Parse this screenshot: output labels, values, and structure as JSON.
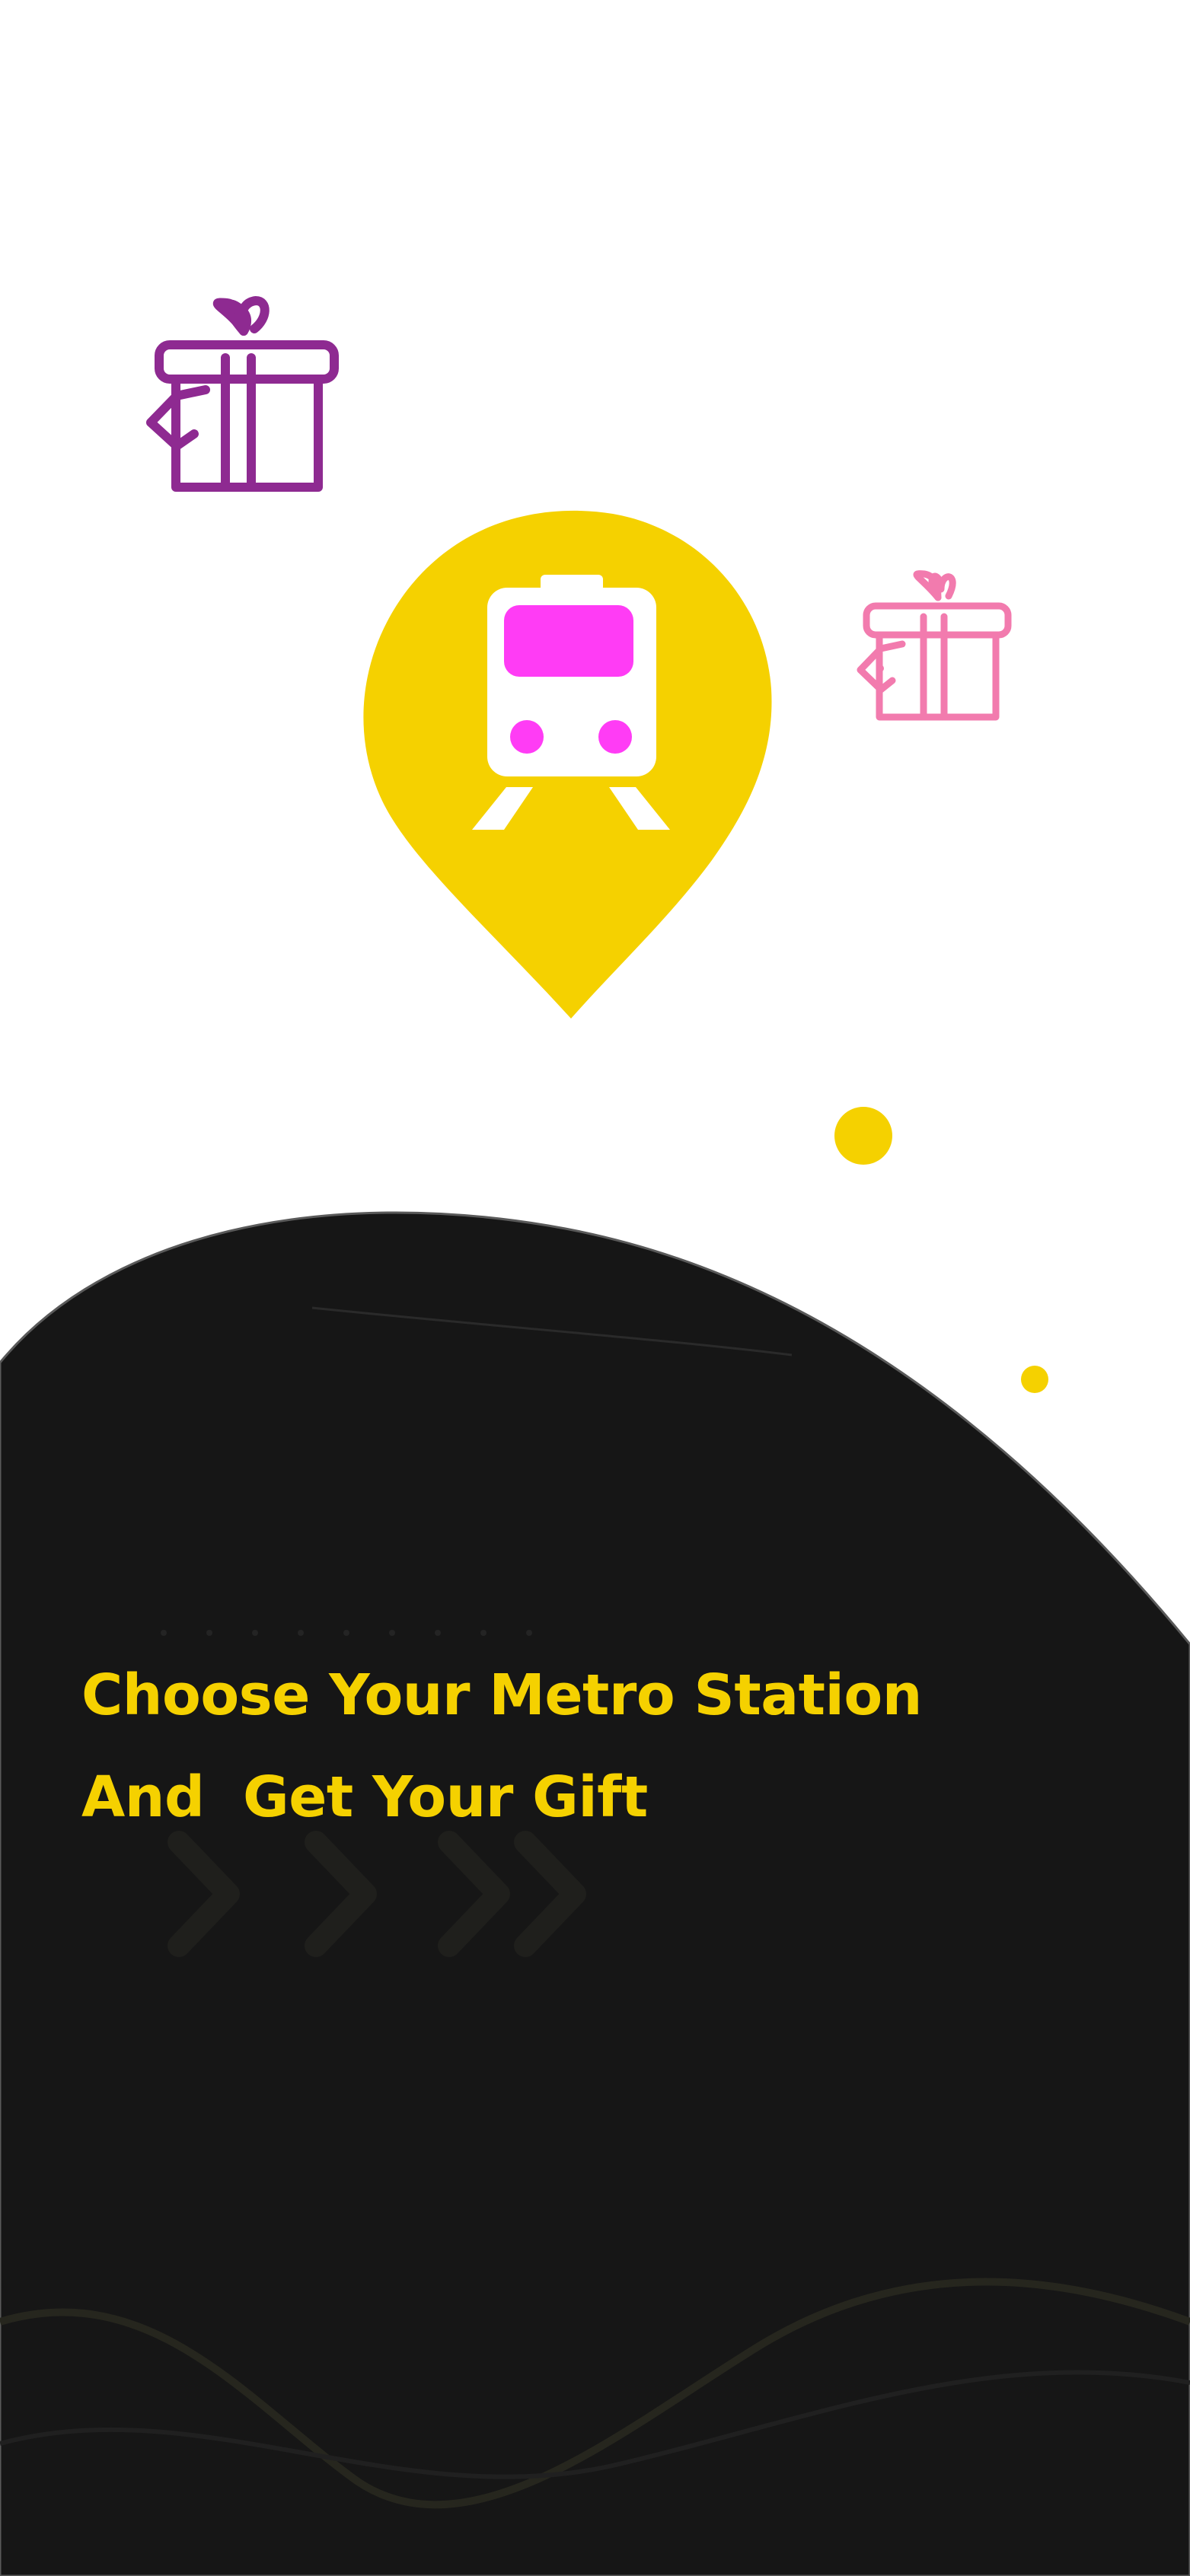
{
  "screen": {
    "name": "onboarding",
    "headline": {
      "line_1": "Choose Your Metro Station",
      "line_2": "And  Get Your Gift"
    }
  },
  "colors": {
    "accent_yellow": "#f5d100",
    "dark_background": "#161616",
    "gift_purple": "#8e2a91",
    "gift_pink": "#f27bae",
    "train_magenta": "#ff3cf5",
    "white": "#ffffff"
  },
  "icons": {
    "gift_large": "gift-icon",
    "gift_small": "gift-icon",
    "location_pin": "map-pin-icon",
    "train": "metro-train-icon"
  }
}
